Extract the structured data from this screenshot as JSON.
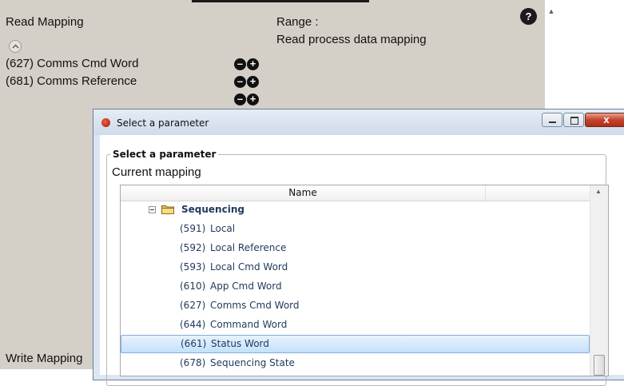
{
  "background": {
    "read_mapping_title": "Read Mapping",
    "range_label": "Range  :",
    "range_description": "Read process data mapping",
    "mapped_rows": [
      "(627) Comms Cmd Word",
      "(681) Comms Reference"
    ],
    "write_mapping_title": "Write Mapping",
    "help_icon": "?",
    "plus_symbol": "+",
    "minus_symbol": "–"
  },
  "dialog": {
    "title": "Select a parameter",
    "close_symbol": "x",
    "group_title": "Select a parameter",
    "current_mapping_label": "Current mapping",
    "tree": {
      "column_header": "Name",
      "folder": "Sequencing",
      "items": [
        {
          "id": "(591)",
          "name": "Local"
        },
        {
          "id": "(592)",
          "name": "Local Reference"
        },
        {
          "id": "(593)",
          "name": "Local Cmd Word"
        },
        {
          "id": "(610)",
          "name": "App Cmd Word"
        },
        {
          "id": "(627)",
          "name": "Comms Cmd Word"
        },
        {
          "id": "(644)",
          "name": "Command Word"
        },
        {
          "id": "(661)",
          "name": "Status Word"
        },
        {
          "id": "(678)",
          "name": "Sequencing State"
        }
      ],
      "selected_index": 6
    }
  },
  "colors": {
    "panel_bg": "#d4d0c8",
    "tree_text": "#1e395b",
    "selection_bg": "#c4e0fb"
  }
}
